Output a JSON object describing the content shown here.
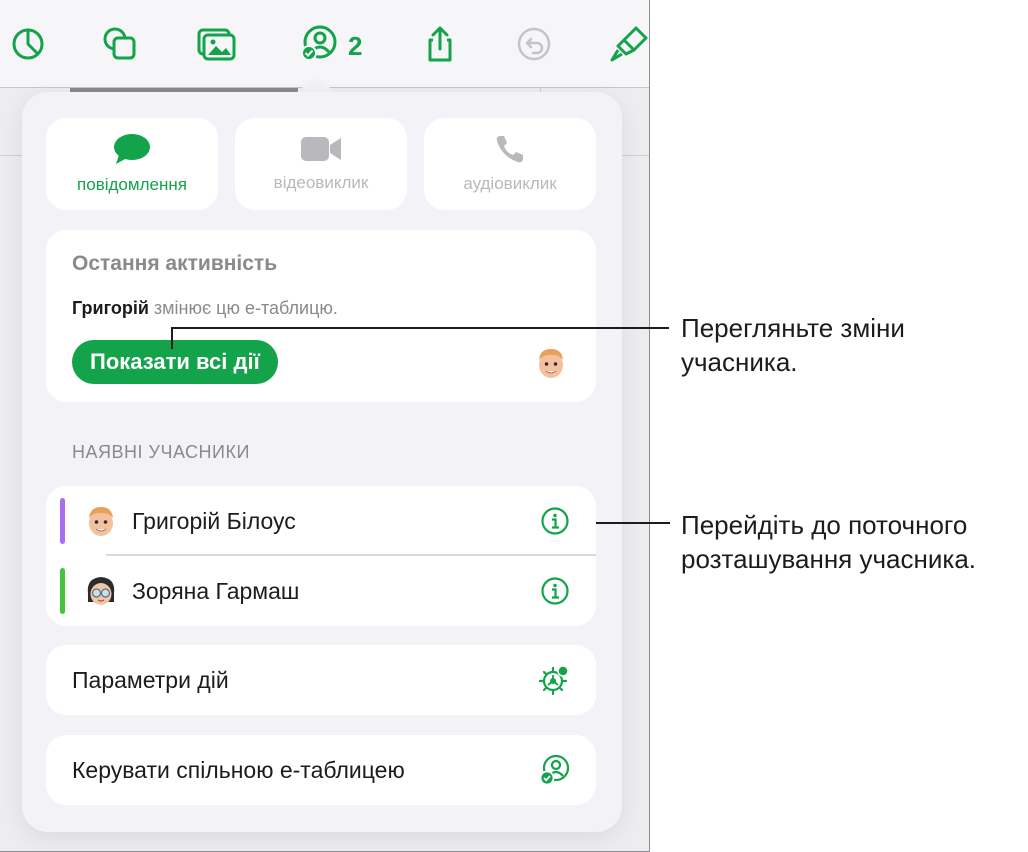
{
  "toolbar": {
    "collaborator_count": "2"
  },
  "contact_buttons": [
    {
      "label": "повідомлення",
      "icon": "message-bubble-icon",
      "active": true
    },
    {
      "label": "відеовиклик",
      "icon": "video-camera-icon",
      "active": false
    },
    {
      "label": "аудіовиклик",
      "icon": "phone-icon",
      "active": false
    }
  ],
  "recent_activity": {
    "title": "Остання активність",
    "user": "Григорій",
    "text": " змінює цю е-таблицю.",
    "button_label": "Показати всі дії"
  },
  "participants": {
    "section_label": "НАЯВНІ УЧАСНИКИ",
    "items": [
      {
        "name": "Григорій Білоус",
        "color": "#a86ff0"
      },
      {
        "name": "Зоряна Гармаш",
        "color": "#45c43c"
      }
    ]
  },
  "menu": {
    "activity_settings": "Параметри дій",
    "manage_shared": "Керувати спільною е-таблицею"
  },
  "callouts": {
    "view_changes": "Перегляньте зміни\nучасника.",
    "go_to_location_line1": "Перейдіть до поточного",
    "go_to_location_line2": "розташування учасника."
  },
  "colors": {
    "accent": "#13a34b",
    "secondary_text": "#8a8a8e",
    "disabled": "#b8b8bd"
  }
}
